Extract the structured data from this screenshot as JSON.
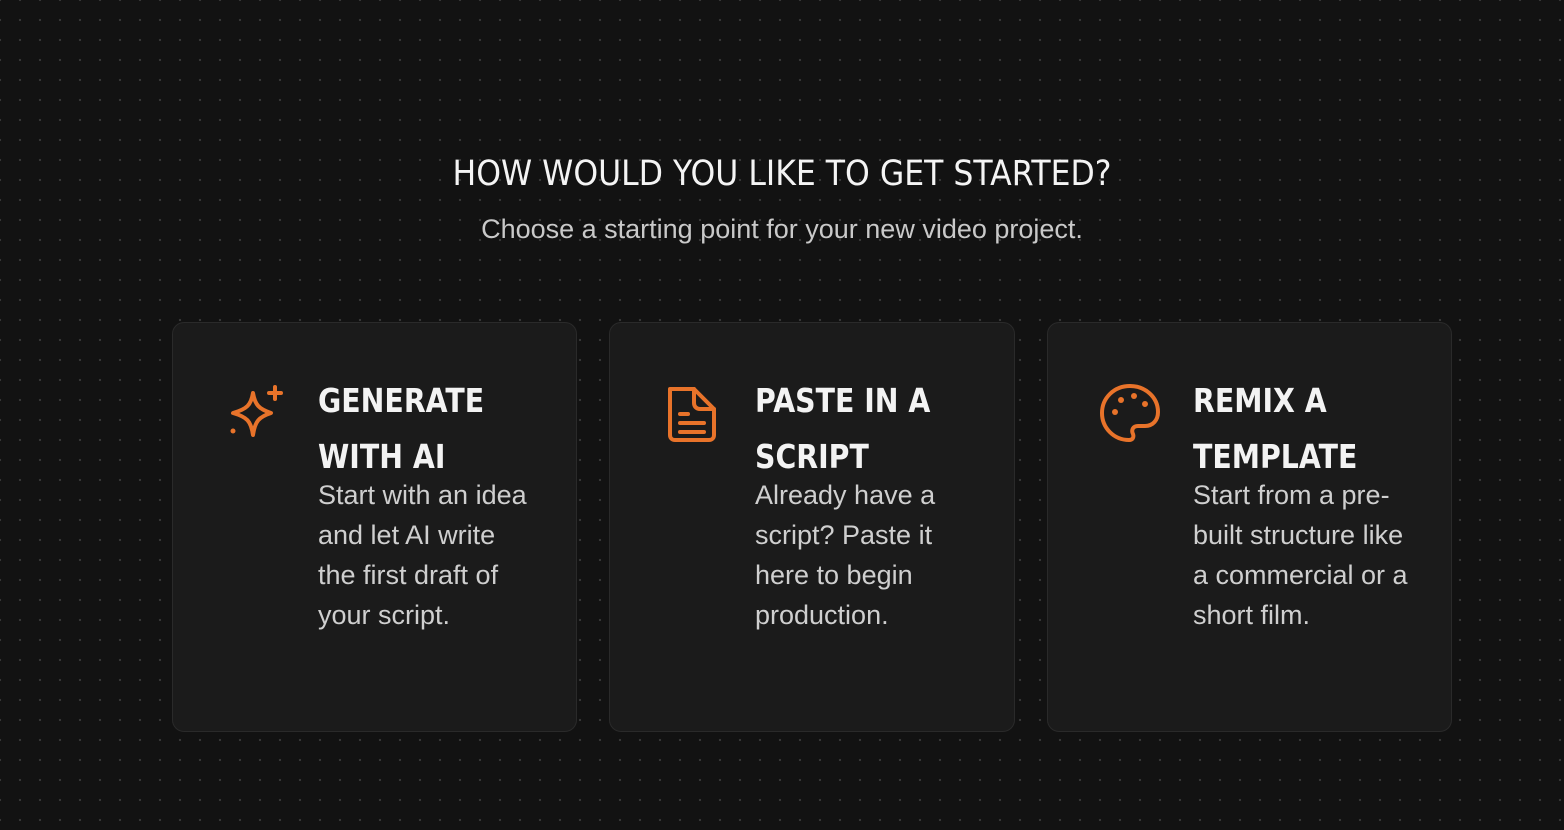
{
  "header": {
    "title": "HOW WOULD YOU LIKE TO GET STARTED?",
    "subtitle": "Choose a starting point for your new video project."
  },
  "colors": {
    "background": "#121212",
    "card": "#1b1b1b",
    "accent": "#e8732a"
  },
  "cards": [
    {
      "icon": "sparkle-icon",
      "title_line1": "GENERATE",
      "title_line2": "WITH AI",
      "description": "Start with an idea and let AI write the first draft of your script."
    },
    {
      "icon": "document-icon",
      "title_line1": "PASTE IN A",
      "title_line2": "SCRIPT",
      "description": "Already have a script? Paste it here to begin production."
    },
    {
      "icon": "palette-icon",
      "title_line1": "REMIX A",
      "title_line2": "TEMPLATE",
      "description": "Start from a pre-built structure like a commercial or a short film."
    }
  ]
}
